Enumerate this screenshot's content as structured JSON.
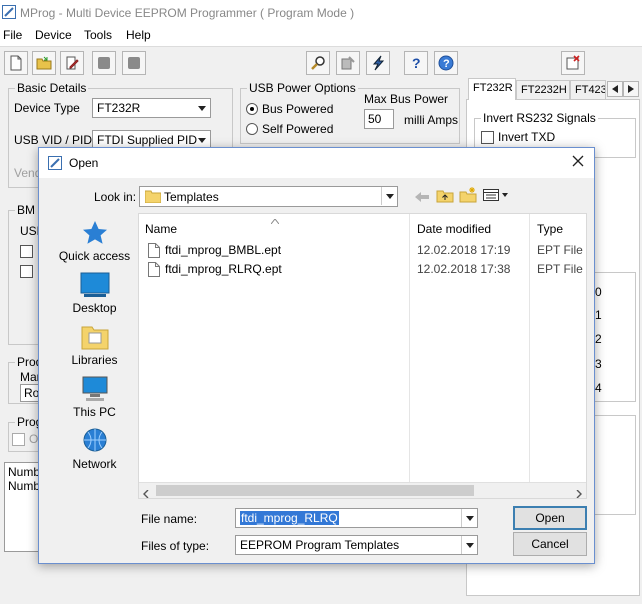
{
  "window": {
    "title": "MProg - Multi Device EEPROM Programmer ( Program Mode )",
    "menu": [
      "File",
      "Device",
      "Tools",
      "Help"
    ]
  },
  "basic_details": {
    "title": "Basic Details",
    "device_type_label": "Device Type",
    "device_type_value": "FT232R",
    "vid_pid_label": "USB VID / PID",
    "vid_pid_value": "FTDI Supplied PID",
    "vendor_label_fragment": "Vend"
  },
  "usb_power": {
    "title": "USB Power Options",
    "bus_powered": "Bus Powered",
    "self_powered": "Self Powered",
    "max_power_label": "Max Bus Power",
    "max_power_value": "50",
    "units": "milli Amps"
  },
  "bm_group": {
    "title_fragment": "BM /",
    "usb_fragment": "USB"
  },
  "product_group": {
    "title_fragment": "Prod",
    "manuf_fragment": "Man",
    "value_fragment": "Ros"
  },
  "program_group": {
    "title_fragment": "Prog",
    "option_fragment": "O"
  },
  "log": {
    "line1": "Numb",
    "line2": "Numb"
  },
  "tabs": [
    "FT232R",
    "FT2232H",
    "FT423"
  ],
  "rs232": {
    "title": "Invert RS232 Signals",
    "invert_txd": "Invert TXD"
  },
  "cbus_fragments": [
    "0",
    "1",
    "2",
    "3",
    "4"
  ],
  "dialog": {
    "title": "Open",
    "look_in_label": "Look in:",
    "look_in_value": "Templates",
    "places": [
      "Quick access",
      "Desktop",
      "Libraries",
      "This PC",
      "Network"
    ],
    "columns": {
      "name": "Name",
      "date": "Date modified",
      "type": "Type"
    },
    "files": [
      {
        "name": "ftdi_mprog_BMBL.ept",
        "date": "12.02.2018 17:19",
        "type": "EPT File"
      },
      {
        "name": "ftdi_mprog_RLRQ.ept",
        "date": "12.02.2018 17:38",
        "type": "EPT File"
      }
    ],
    "filename_label": "File name:",
    "filename_value": "ftdi_mprog_RLRQ",
    "filetype_label": "Files of type:",
    "filetype_value": "EEPROM Program Templates",
    "open_button": "Open",
    "cancel_button": "Cancel"
  }
}
